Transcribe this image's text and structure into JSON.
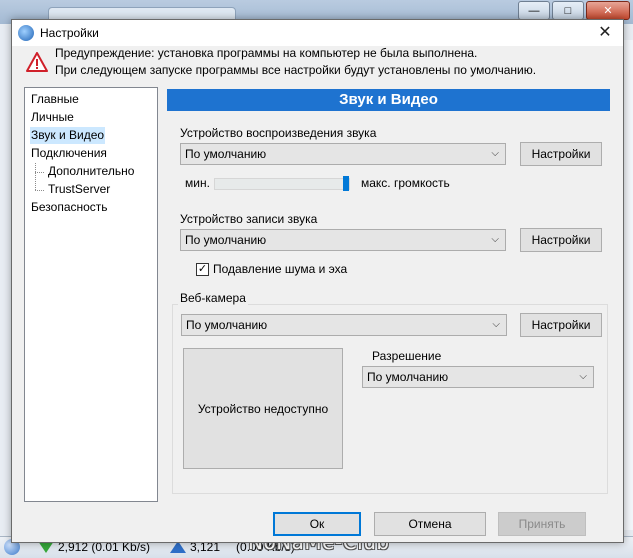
{
  "background": {
    "status": {
      "download": "2,912 (0.01 Kb/s)",
      "upload": "3,121",
      "upload_rate": "(0.00 Kb/s)"
    },
    "window_buttons": {
      "minimize": "—",
      "maximize": "□",
      "close": "✕"
    },
    "watermark": "NoNaMe-Club"
  },
  "dialog": {
    "title": "Настройки",
    "close": "✕",
    "warning": {
      "line1": "Предупреждение: установка программы на компьютер не была выполнена.",
      "line2": "При следующем запуске программы все настройки будут установлены по умолчанию."
    },
    "nav": [
      {
        "label": "Главные"
      },
      {
        "label": "Личные"
      },
      {
        "label": "Звук и Видео"
      },
      {
        "label": "Подключения"
      },
      {
        "label": "Дополнительно"
      },
      {
        "label": "TrustServer"
      },
      {
        "label": "Безопасность"
      }
    ],
    "section": {
      "title": "Звук и Видео",
      "playback": {
        "label": "Устройство воспроизведения звука",
        "value": "По умолчанию",
        "settings_button": "Настройки",
        "volume_min_label": "мин.",
        "volume_max_label": "макс. громкость",
        "volume": 0.97
      },
      "record": {
        "label": "Устройство записи звука",
        "value": "По умолчанию",
        "settings_button": "Настройки",
        "noise_label": "Подавление шума и эха",
        "noise_checked": true,
        "check_glyph": "✓"
      },
      "webcam": {
        "label": "Веб-камера",
        "value": "По умолчанию",
        "settings_button": "Настройки",
        "preview_text": "Устройство недоступно",
        "resolution_label": "Разрешение",
        "resolution_value": "По умолчанию"
      }
    },
    "buttons": {
      "ok": "Ок",
      "cancel": "Отмена",
      "apply": "Принять"
    }
  },
  "colors": {
    "accent": "#1e73d0",
    "selection": "#cce8ff"
  },
  "icons": {
    "dropdown": "⌵"
  }
}
